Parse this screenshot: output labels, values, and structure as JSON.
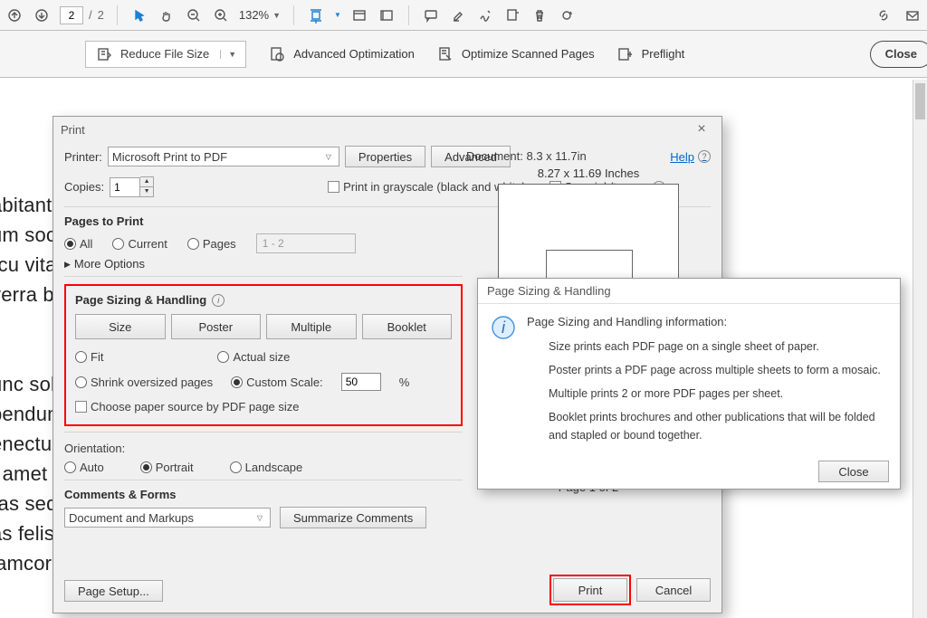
{
  "toolbar": {
    "page_current": "2",
    "page_total": "2",
    "zoom": "132%",
    "reduce_label": "Reduce File Size",
    "adv_opt_label": "Advanced Optimization",
    "opt_scan_label": "Optimize Scanned Pages",
    "preflight_label": "Preflight",
    "close_label": "Close"
  },
  "doc_text": "abitant duis nunc vel orci sodales cras lacus congue nisi.\num sociis penatibus integer hac pellentesque tortor bibendum\nrcu vitae habitant molestie elit aenean curabitur viverra. Sed\nverra blandit sit parturient.\n\n\nunc sollicitudin feugiat turpis elit velit elit suspendisse\nbendum velit tincidunt. Diam est sapien tristique enim\nenectus tristique porta pede consectetuer ultricies facilisis\nt amet magnis porta pretium nibh cubilia fames dignissim.\nras sed justo convallis. Volutpat quisque libero nulla facilisi\nas felis. Elementum a lorem consequat dictum mattis\nlamcorper cras molestie tincidunt platea metus aliquet aliquet",
  "dialog": {
    "title": "Print",
    "printer_label": "Printer:",
    "printer_value": "Microsoft Print to PDF",
    "properties_btn": "Properties",
    "advanced_btn": "Advanced",
    "help_label": "Help",
    "copies_label": "Copies:",
    "copies_value": "1",
    "grayscale_label": "Print in grayscale (black and white)",
    "saveink_label": "Save ink/toner",
    "pages_title": "Pages to Print",
    "opt_all": "All",
    "opt_current": "Current",
    "opt_pages": "Pages",
    "pages_range": "1 - 2",
    "more_options": "More Options",
    "sizing_title": "Page Sizing & Handling",
    "tab_size": "Size",
    "tab_poster": "Poster",
    "tab_multiple": "Multiple",
    "tab_booklet": "Booklet",
    "fit": "Fit",
    "actual": "Actual size",
    "shrink": "Shrink oversized pages",
    "custom_scale": "Custom Scale:",
    "scale_value": "50",
    "percent": "%",
    "paper_source": "Choose paper source by PDF page size",
    "orientation_title": "Orientation:",
    "orient_auto": "Auto",
    "orient_portrait": "Portrait",
    "orient_landscape": "Landscape",
    "comments_title": "Comments & Forms",
    "comments_value": "Document and Markups",
    "summarize_btn": "Summarize Comments",
    "page_setup_btn": "Page Setup...",
    "doc_dim": "Document: 8.3 x 11.7in",
    "preview_dim": "8.27 x 11.69 Inches",
    "page_of": "Page 1 of 2",
    "print_btn": "Print",
    "cancel_btn": "Cancel"
  },
  "popup": {
    "title": "Page Sizing & Handling",
    "heading": "Page Sizing and Handling information:",
    "line_size": "Size prints each PDF page on a single sheet of paper.",
    "line_poster": "Poster prints a PDF page across multiple sheets to form a mosaic.",
    "line_multiple": "Multiple prints 2 or more PDF pages per sheet.",
    "line_booklet": "Booklet prints brochures and other publications that will be folded and stapled or bound together.",
    "close_btn": "Close"
  }
}
